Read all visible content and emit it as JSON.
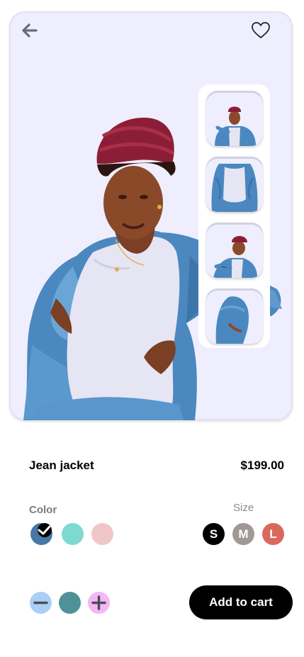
{
  "product": {
    "name": "Jean jacket",
    "price": "$199.00",
    "main_image": "model-photo"
  },
  "header": {
    "back_icon": "arrow-left-icon",
    "favorite_icon": "heart-icon"
  },
  "thumbnails": [
    {
      "label": "front-view-thumbnail"
    },
    {
      "label": "jacket-open-thumbnail"
    },
    {
      "label": "side-pose-thumbnail"
    },
    {
      "label": "back-view-thumbnail"
    }
  ],
  "color": {
    "label": "Color",
    "options": [
      {
        "name": "denim-blue",
        "hex": "#4677a6",
        "selected": true
      },
      {
        "name": "teal",
        "hex": "#7fd9d3",
        "selected": false
      },
      {
        "name": "pink",
        "hex": "#f1c6c8",
        "selected": false
      }
    ]
  },
  "size": {
    "label": "Size",
    "options": [
      {
        "label": "S",
        "hex": "#000000"
      },
      {
        "label": "M",
        "hex": "#a39796"
      },
      {
        "label": "L",
        "hex": "#d9695e"
      }
    ]
  },
  "quantity": {
    "minus_icon": "minus-icon",
    "plus_icon": "plus-icon",
    "indicator_color": "#4e9297"
  },
  "actions": {
    "add_to_cart": "Add to cart"
  }
}
